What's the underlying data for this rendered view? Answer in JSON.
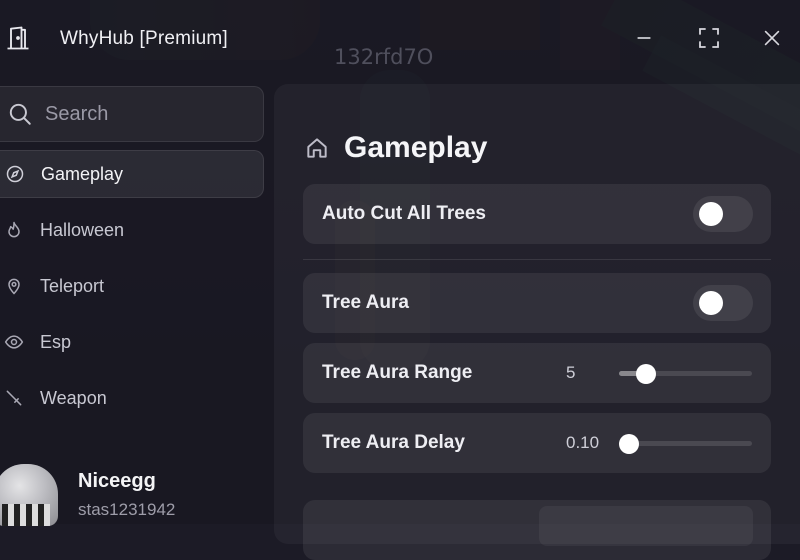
{
  "app": {
    "title": "WhyHub [Premium]",
    "watermark": "132rfd7O"
  },
  "window_controls": {
    "minimize": "minimize-icon",
    "maximize": "maximize-icon",
    "close": "close-icon"
  },
  "search": {
    "placeholder": "Search",
    "icon": "search-icon"
  },
  "sidebar": {
    "items": [
      {
        "label": "Gameplay",
        "icon": "compass-icon",
        "active": true
      },
      {
        "label": "Halloween",
        "icon": "flame-icon",
        "active": false
      },
      {
        "label": "Teleport",
        "icon": "map-pin-icon",
        "active": false
      },
      {
        "label": "Esp",
        "icon": "eye-icon",
        "active": false
      },
      {
        "label": "Weapon",
        "icon": "sword-icon",
        "active": false
      }
    ]
  },
  "profile": {
    "display_name": "Niceegg",
    "username": "stas1231942"
  },
  "page": {
    "title": "Gameplay",
    "icon": "home-icon"
  },
  "settings": {
    "auto_cut": {
      "label": "Auto Cut All Trees",
      "enabled": false
    },
    "tree_aura": {
      "label": "Tree Aura",
      "enabled": false
    },
    "tree_aura_range": {
      "label": "Tree Aura Range",
      "value": "5",
      "fraction": 0.14
    },
    "tree_aura_delay": {
      "label": "Tree Aura Delay",
      "value": "0.10",
      "fraction": 0.0
    }
  },
  "colors": {
    "accent": "#ffffff",
    "panel": "#181721",
    "text": "#eeeef3",
    "muted": "#9e9da9"
  }
}
